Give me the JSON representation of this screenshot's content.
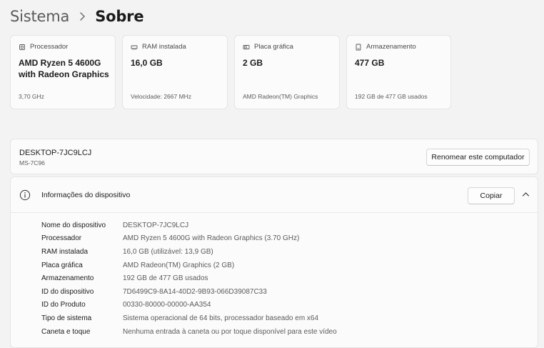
{
  "breadcrumb": {
    "parent": "Sistema",
    "separator": "›",
    "current": "Sobre"
  },
  "cards": [
    {
      "icon": "cpu-icon",
      "label": "Processador",
      "value": "AMD Ryzen 5 4600G with Radeon Graphics",
      "detail": "3,70 GHz"
    },
    {
      "icon": "ram-icon",
      "label": "RAM instalada",
      "value": "16,0 GB",
      "detail": "Velocidade: 2667 MHz"
    },
    {
      "icon": "gpu-icon",
      "label": "Placa gráfica",
      "value": "2 GB",
      "detail": "AMD Radeon(TM) Graphics"
    },
    {
      "icon": "storage-icon",
      "label": "Armazenamento",
      "value": "477 GB",
      "detail": "192 GB de 477 GB usados"
    }
  ],
  "device": {
    "name": "DESKTOP-7JC9LCJ",
    "model": "MS-7C96",
    "rename_label": "Renomear este computador"
  },
  "device_info": {
    "title": "Informações do dispositivo",
    "copy_label": "Copiar",
    "rows": [
      {
        "label": "Nome do dispositivo",
        "value": "DESKTOP-7JC9LCJ"
      },
      {
        "label": "Processador",
        "value": "AMD Ryzen 5 4600G with Radeon Graphics (3.70 GHz)"
      },
      {
        "label": "RAM instalada",
        "value": "16,0 GB (utilizável: 13,9 GB)"
      },
      {
        "label": "Placa gráfica",
        "value": "AMD Radeon(TM) Graphics (2 GB)"
      },
      {
        "label": "Armazenamento",
        "value": "192 GB de 477 GB usados"
      },
      {
        "label": "ID do dispositivo",
        "value": "7D6499C9-8A14-40D2-9B93-066D39087C33"
      },
      {
        "label": "ID do Produto",
        "value": "00330-80000-00000-AA354"
      },
      {
        "label": "Tipo de sistema",
        "value": "Sistema operacional de 64 bits, processador baseado em x64"
      },
      {
        "label": "Caneta e toque",
        "value": "Nenhuma entrada à caneta ou por toque disponível para este vídeo"
      }
    ]
  }
}
